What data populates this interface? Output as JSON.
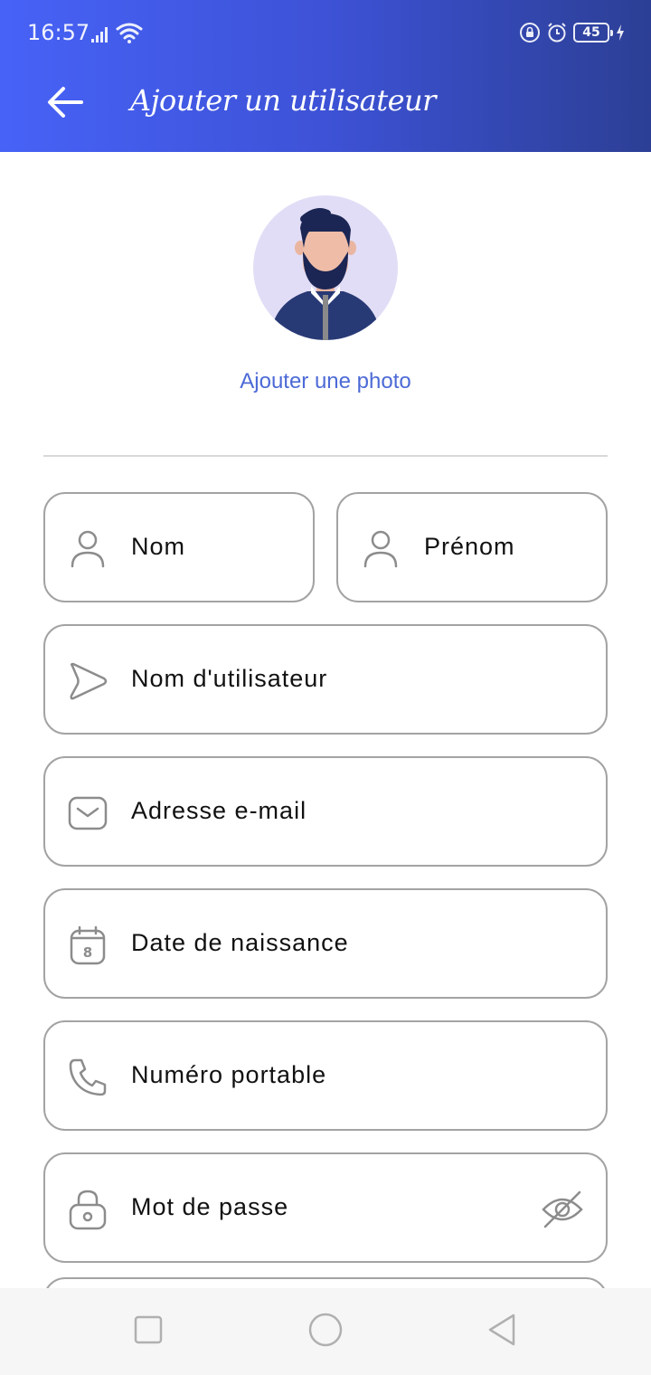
{
  "status_bar": {
    "time": "16:57",
    "battery": "45"
  },
  "header": {
    "title": "Ajouter un utilisateur",
    "back_icon": "arrow-left-icon"
  },
  "profile": {
    "avatar_icon": "default-avatar",
    "add_photo_label": "Ajouter une photo"
  },
  "form": {
    "last_name": {
      "label": "Nom",
      "icon": "person-icon"
    },
    "first_name": {
      "label": "Prénom",
      "icon": "person-icon"
    },
    "username": {
      "label": "Nom d'utilisateur",
      "icon": "send-icon"
    },
    "email": {
      "label": "Adresse e-mail",
      "icon": "mail-icon"
    },
    "birth_date": {
      "label": "Date de naissance",
      "icon": "calendar-icon",
      "calendar_day": "8"
    },
    "mobile": {
      "label": "Numéro portable",
      "icon": "phone-icon"
    },
    "password": {
      "label": "Mot de passe",
      "icon": "lock-icon",
      "toggle_icon": "eye-off-icon"
    }
  },
  "colors": {
    "header_start": "#4762f7",
    "header_end": "#2c3f95",
    "link": "#4c6ad6",
    "field_border": "#a3a3a3"
  }
}
